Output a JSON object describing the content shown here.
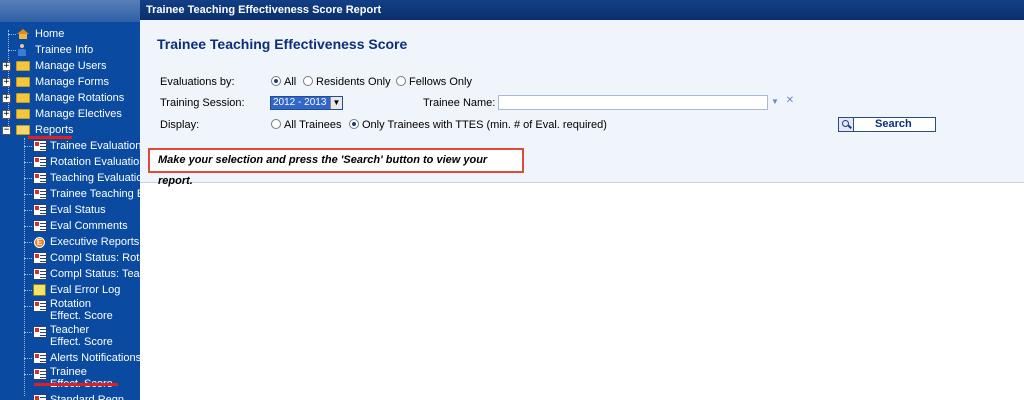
{
  "window": {
    "title": "Trainee Teaching Effectiveness Score Report"
  },
  "sidebar": {
    "items": [
      {
        "label": "Home"
      },
      {
        "label": "Trainee Info"
      },
      {
        "label": "Manage Users"
      },
      {
        "label": "Manage Forms"
      },
      {
        "label": "Manage Rotations"
      },
      {
        "label": "Manage Electives"
      },
      {
        "label": "Reports"
      },
      {
        "label": "Trainee Evaluations"
      },
      {
        "label": "Rotation Evaluations"
      },
      {
        "label": "Teaching Evaluations"
      },
      {
        "label": "Trainee Teaching Ev"
      },
      {
        "label": "Eval Status"
      },
      {
        "label": "Eval Comments"
      },
      {
        "label": "Executive Reports"
      },
      {
        "label": "Compl Status: Rotatio"
      },
      {
        "label": "Compl Status: Teach"
      },
      {
        "label": "Eval Error Log"
      },
      {
        "label": "Rotation\nEffect. Score"
      },
      {
        "label": "Teacher\nEffect. Score"
      },
      {
        "label": "Alerts Notifications"
      },
      {
        "label": "Trainee\nEffect. Score"
      },
      {
        "label": "Standard Regn"
      }
    ]
  },
  "main": {
    "page_title": "Trainee Teaching Effectiveness Score",
    "evaluations_by": {
      "label": "Evaluations by:",
      "options": [
        "All",
        "Residents Only",
        "Fellows Only"
      ],
      "selected": "All"
    },
    "training_session": {
      "label": "Training Session:",
      "value": "2012 - 2013"
    },
    "trainee_name": {
      "label": "Trainee Name:",
      "value": ""
    },
    "display": {
      "label": "Display:",
      "options": [
        "All Trainees",
        "Only Trainees with TTES (min. # of Eval. required)"
      ],
      "selected": "Only Trainees with TTES (min. # of Eval. required)"
    },
    "search_label": "Search",
    "instruction": "Make your selection and press the 'Search' button to view your report."
  }
}
